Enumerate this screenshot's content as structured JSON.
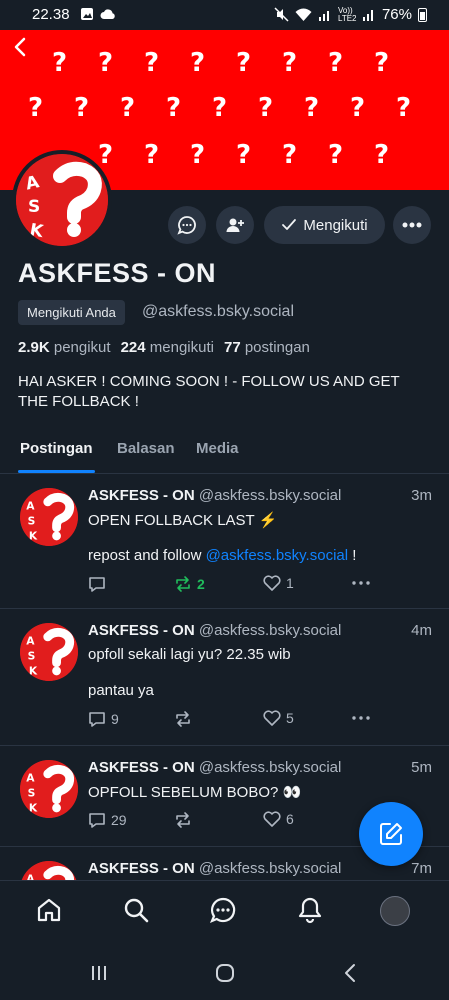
{
  "status_bar": {
    "time": "22.38",
    "battery": "76%",
    "lte_label": "Vo)) LTE2"
  },
  "banner": {
    "glyph": "?",
    "color": "#ff0000"
  },
  "profile": {
    "avatar_text": "ASK",
    "name": "ASKFESS - ON",
    "follows_you": "Mengikuti Anda",
    "handle": "@askfess.bsky.social",
    "following_button": "Mengikuti",
    "followers_count": "2.9K",
    "followers_label": "pengikut",
    "following_count": "224",
    "following_label": "mengikuti",
    "posts_count": "77",
    "posts_label": "postingan",
    "bio": "HAI ASKER ! COMING SOON ! - FOLLOW US AND GET THE FOLLBACK !"
  },
  "tabs": [
    {
      "label": "Postingan",
      "active": true
    },
    {
      "label": "Balasan",
      "active": false
    },
    {
      "label": "Media",
      "active": false
    }
  ],
  "posts": [
    {
      "author": "ASKFESS - ON",
      "handle": "@askfess.bsky.social",
      "time": "3m",
      "line1": "OPEN FOLLBACK LAST ⚡",
      "line2_prefix": "repost and follow ",
      "line2_link": "@askfess.bsky.social",
      "line2_suffix": " !",
      "replies": "",
      "reposts": "2",
      "likes": "1"
    },
    {
      "author": "ASKFESS - ON",
      "handle": "@askfess.bsky.social",
      "time": "4m",
      "line1": "opfoll sekali lagi yu? 22.35 wib",
      "line2_prefix": "pantau ya",
      "replies": "9",
      "reposts": "",
      "likes": "5"
    },
    {
      "author": "ASKFESS - ON",
      "handle": "@askfess.bsky.social",
      "time": "5m",
      "line1": "OPFOLL SEBELUM BOBO? 👀",
      "replies": "29",
      "reposts": "",
      "likes": "6"
    },
    {
      "author": "ASKFESS - ON",
      "handle": "@askfess.bsky.social",
      "time": "7m"
    }
  ],
  "colors": {
    "background": "#161e27",
    "accent": "#1083fe",
    "repost_active": "#20bc5c",
    "avatar_red": "#e11d1d"
  },
  "icons": {
    "nav": [
      "home-icon",
      "search-icon",
      "chat-icon",
      "bell-icon",
      "profile-avatar"
    ],
    "system": [
      "recents-icon",
      "home-circle-icon",
      "back-chevron-icon"
    ]
  }
}
